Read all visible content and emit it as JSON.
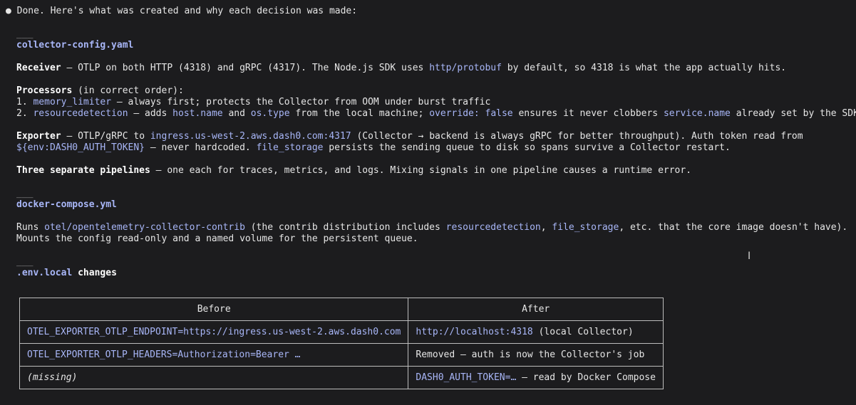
{
  "intro": "Done. Here's what was created and why each decision was made:",
  "rule": "___",
  "collector": {
    "filename": "collector-config.yaml",
    "receiver": {
      "label": "Receiver",
      "text1": " — OTLP on both HTTP (4318) and gRPC (4317). The Node.js SDK uses ",
      "code1": "http/protobuf",
      "text2": " by default, so 4318 is what the app actually hits."
    },
    "processors": {
      "label": "Processors",
      "suffix": " (in correct order):",
      "item1": {
        "num": "1. ",
        "code": "memory_limiter",
        "text": " — always first; protects the Collector from OOM under burst traffic"
      },
      "item2": {
        "num": "2. ",
        "code1": "resourcedetection",
        "text1": " — adds ",
        "code2": "host.name",
        "text2": " and ",
        "code3": "os.type",
        "text3": " from the local machine; ",
        "code4": "override: false",
        "text4": " ensures it never clobbers ",
        "code5": "service.name",
        "text5": " already set by the SDK"
      }
    },
    "exporter": {
      "label": "Exporter",
      "text1": " — OTLP/gRPC to ",
      "code1": "ingress.us-west-2.aws.dash0.com:4317",
      "text2": " (Collector → backend is always gRPC for better throughput). Auth token read from",
      "code2": "${env:DASH0_AUTH_TOKEN}",
      "text3": " — never hardcoded. ",
      "code3": "file_storage",
      "text4": " persists the sending queue to disk so spans survive a Collector restart."
    },
    "pipelines": {
      "label": "Three separate pipelines",
      "text": " — one each for traces, metrics, and logs. Mixing signals in one pipeline causes a runtime error."
    }
  },
  "compose": {
    "filename": "docker-compose.yml",
    "text1": "Runs ",
    "code1": "otel/opentelemetry-collector-contrib",
    "text2": " (the contrib distribution includes ",
    "code2": "resourcedetection",
    "text3": ", ",
    "code3": "file_storage",
    "text4": ", etc. that the core image doesn't have).",
    "line2": "Mounts the config read-only and a named volume for the persistent queue."
  },
  "env": {
    "code": ".env.local",
    "suffix": " changes"
  },
  "table": {
    "headers": [
      "Before",
      "After"
    ],
    "rows": [
      {
        "before": "OTEL_EXPORTER_OTLP_ENDPOINT=https://ingress.us-west-2.aws.dash0.com",
        "after_code": "http://localhost:4318",
        "after_text": " (local Collector)"
      },
      {
        "before": "OTEL_EXPORTER_OTLP_HEADERS=Authorization=Bearer …",
        "after_code": "",
        "after_text": "Removed — auth is now the Collector's job"
      },
      {
        "before": "(missing)",
        "after_code": "DASH0_AUTH_TOKEN=…",
        "after_text": " — read by Docker Compose"
      }
    ]
  },
  "colors": {
    "background": "#1c1c1e",
    "text": "#e6e6e6",
    "code": "#a8b6f7"
  },
  "icons": {
    "bullet": "●",
    "text_cursor": "I"
  }
}
